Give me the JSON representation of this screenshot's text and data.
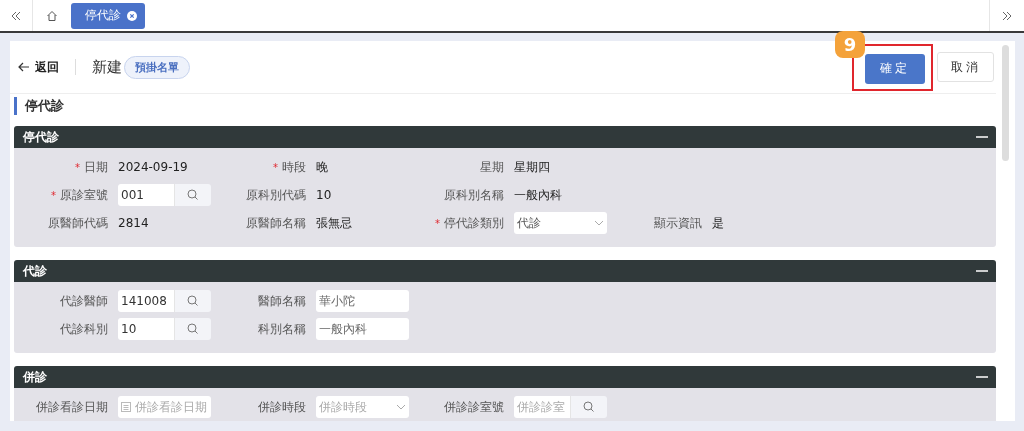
{
  "tab_strip": {
    "tabs": [
      {
        "label": "停代診",
        "selected": true
      }
    ]
  },
  "header": {
    "back_link": "返回",
    "title": "新建",
    "badge": "預掛名單",
    "callout": {
      "step": "9"
    },
    "buttons": [
      {
        "label": "確定",
        "kind": "primary",
        "highlighted": true
      },
      {
        "label": "取消",
        "kind": "default",
        "highlighted": false
      }
    ]
  },
  "section_title": "停代診",
  "panels": [
    {
      "title": "停代診",
      "expanded": true,
      "rows": [
        [
          {
            "label": "日期",
            "required_mark": "*",
            "kind": "text",
            "value": "2024-09-19"
          },
          {
            "label": "時段",
            "required_mark": "*",
            "kind": "text",
            "value": "晚"
          },
          {
            "label": "星期",
            "kind": "text",
            "value": "星期四"
          }
        ],
        [
          {
            "label": "原診室號",
            "required_mark": "*",
            "kind": "lookup",
            "value": "001"
          },
          {
            "label": "原科別代碼",
            "kind": "text",
            "value": "10"
          },
          {
            "label": "原科別名稱",
            "kind": "text",
            "value": "一般內科"
          }
        ],
        [
          {
            "label": "原醫師代碼",
            "kind": "text",
            "value": "2814"
          },
          {
            "label": "原醫師名稱",
            "kind": "text",
            "value": "張無忌"
          },
          {
            "label": "停代診類別",
            "required_mark": "*",
            "kind": "select",
            "value": "代診"
          },
          {
            "label": "顯示資訊",
            "kind": "text",
            "value": "是"
          }
        ]
      ]
    },
    {
      "title": "代診",
      "expanded": true,
      "rows": [
        [
          {
            "label": "代診醫師",
            "kind": "lookup",
            "value": "141008"
          },
          {
            "label": "醫師名稱",
            "kind": "input",
            "value": "華小陀"
          }
        ],
        [
          {
            "label": "代診科別",
            "kind": "lookup",
            "value": "10"
          },
          {
            "label": "科別名稱",
            "kind": "input",
            "value": "一般內科"
          }
        ]
      ]
    },
    {
      "title": "併診",
      "expanded": true,
      "rows": [
        [
          {
            "label": "併診看診日期",
            "kind": "date",
            "placeholder": "併診看診日期"
          },
          {
            "label": "併診時段",
            "kind": "select",
            "placeholder": "併診時段"
          },
          {
            "label": "併診診室號",
            "kind": "lookup",
            "placeholder": "併診診室"
          }
        ]
      ]
    }
  ]
}
